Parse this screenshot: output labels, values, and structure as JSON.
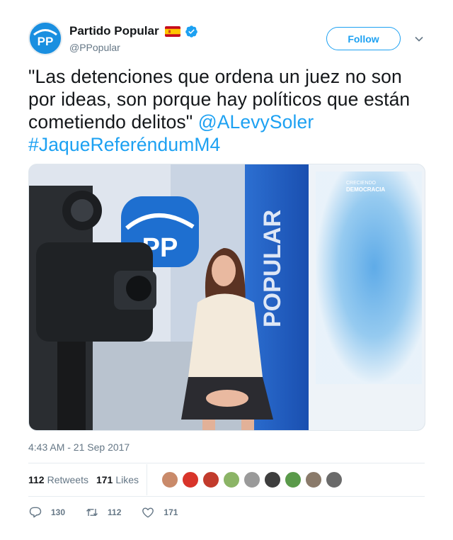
{
  "header": {
    "display_name": "Partido Popular",
    "handle": "@PPopular",
    "avatar_text": "PP",
    "follow_label": "Follow"
  },
  "tweet": {
    "text": "\"Las detenciones que ordena un juez no son por ideas, son porque hay políticos que están cometiendo delitos\"",
    "mention": "@ALevySoler",
    "hashtag": "#JaqueReferéndumM4"
  },
  "media": {
    "backdrop_text": "POPULAR",
    "logo_text": "PP",
    "banner_text_1": "CRECIENDO",
    "banner_text_2": "DEMOCRACIA"
  },
  "timestamp": "4:43 AM - 21 Sep 2017",
  "stats": {
    "retweets_count": "112",
    "retweets_label": "Retweets",
    "likes_count": "171",
    "likes_label": "Likes"
  },
  "actions": {
    "replies": "130",
    "retweets": "112",
    "likes": "171"
  },
  "colors": {
    "accent": "#1da1f2",
    "pp_blue": "#1a8fe0",
    "muted": "#657786"
  }
}
